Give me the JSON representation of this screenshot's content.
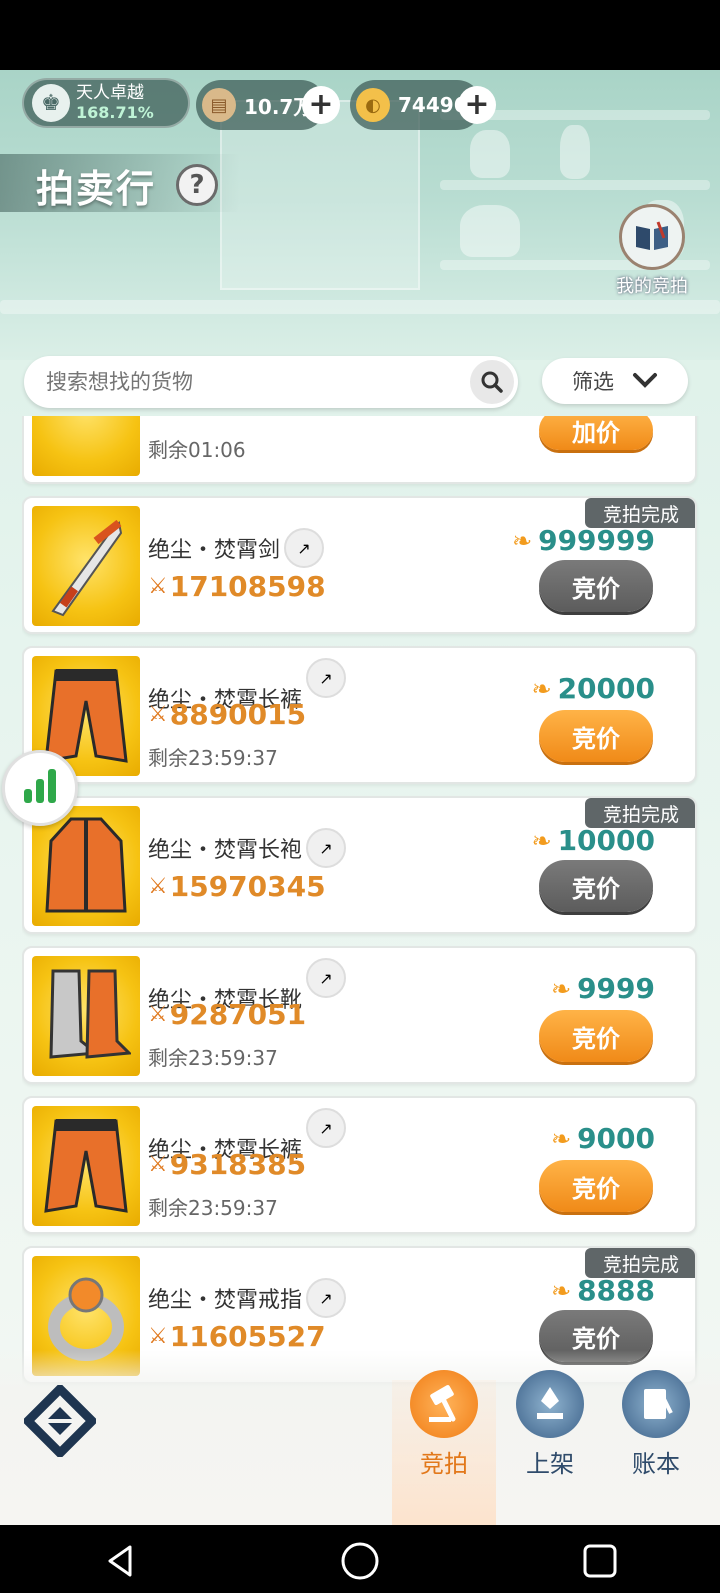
{
  "header": {
    "user_title": "天人卓越",
    "user_percent": "168.71%",
    "currency_1_value": "10.7万",
    "currency_2_value": "74496",
    "page_title": "拍卖行",
    "help_glyph": "?",
    "my_bids_label": "我的竞拍"
  },
  "search": {
    "placeholder": "搜索想找的货物",
    "filter_label": "筛选"
  },
  "partial_item": {
    "remaining": "剩余01:06",
    "button_label": "加价"
  },
  "items": [
    {
      "name": "绝尘・焚霄剑",
      "power": "17108598",
      "price": "999999",
      "button": "竞价",
      "status": "竞拍完成",
      "remaining": "",
      "icon": "sword-icon"
    },
    {
      "name": "绝尘・焚霄长裤",
      "power": "8890015",
      "price": "20000",
      "button": "竞价",
      "status": "",
      "remaining": "剩余23:59:37",
      "icon": "pants-icon"
    },
    {
      "name": "绝尘・焚霄长袍",
      "power": "15970345",
      "price": "10000",
      "button": "竞价",
      "status": "竞拍完成",
      "remaining": "",
      "icon": "robe-icon"
    },
    {
      "name": "绝尘・焚霄长靴",
      "power": "9287051",
      "price": "9999",
      "button": "竞价",
      "status": "",
      "remaining": "剩余23:59:37",
      "icon": "boots-icon"
    },
    {
      "name": "绝尘・焚霄长裤",
      "power": "9318385",
      "price": "9000",
      "button": "竞价",
      "status": "",
      "remaining": "剩余23:59:37",
      "icon": "pants-icon"
    },
    {
      "name": "绝尘・焚霄戒指",
      "power": "11605527",
      "price": "8888",
      "button": "竞价",
      "status": "竞拍完成",
      "remaining": "",
      "icon": "ring-icon"
    }
  ],
  "tabs": [
    {
      "label": "竞拍",
      "icon": "gavel-icon",
      "active": true
    },
    {
      "label": "上架",
      "icon": "listing-icon",
      "active": false
    },
    {
      "label": "账本",
      "icon": "ledger-icon",
      "active": false
    }
  ],
  "colors": {
    "accent_orange": "#f08a18",
    "price_teal": "#2a8f8a",
    "power_orange": "#e08a28",
    "done_badge": "#5f6668"
  }
}
